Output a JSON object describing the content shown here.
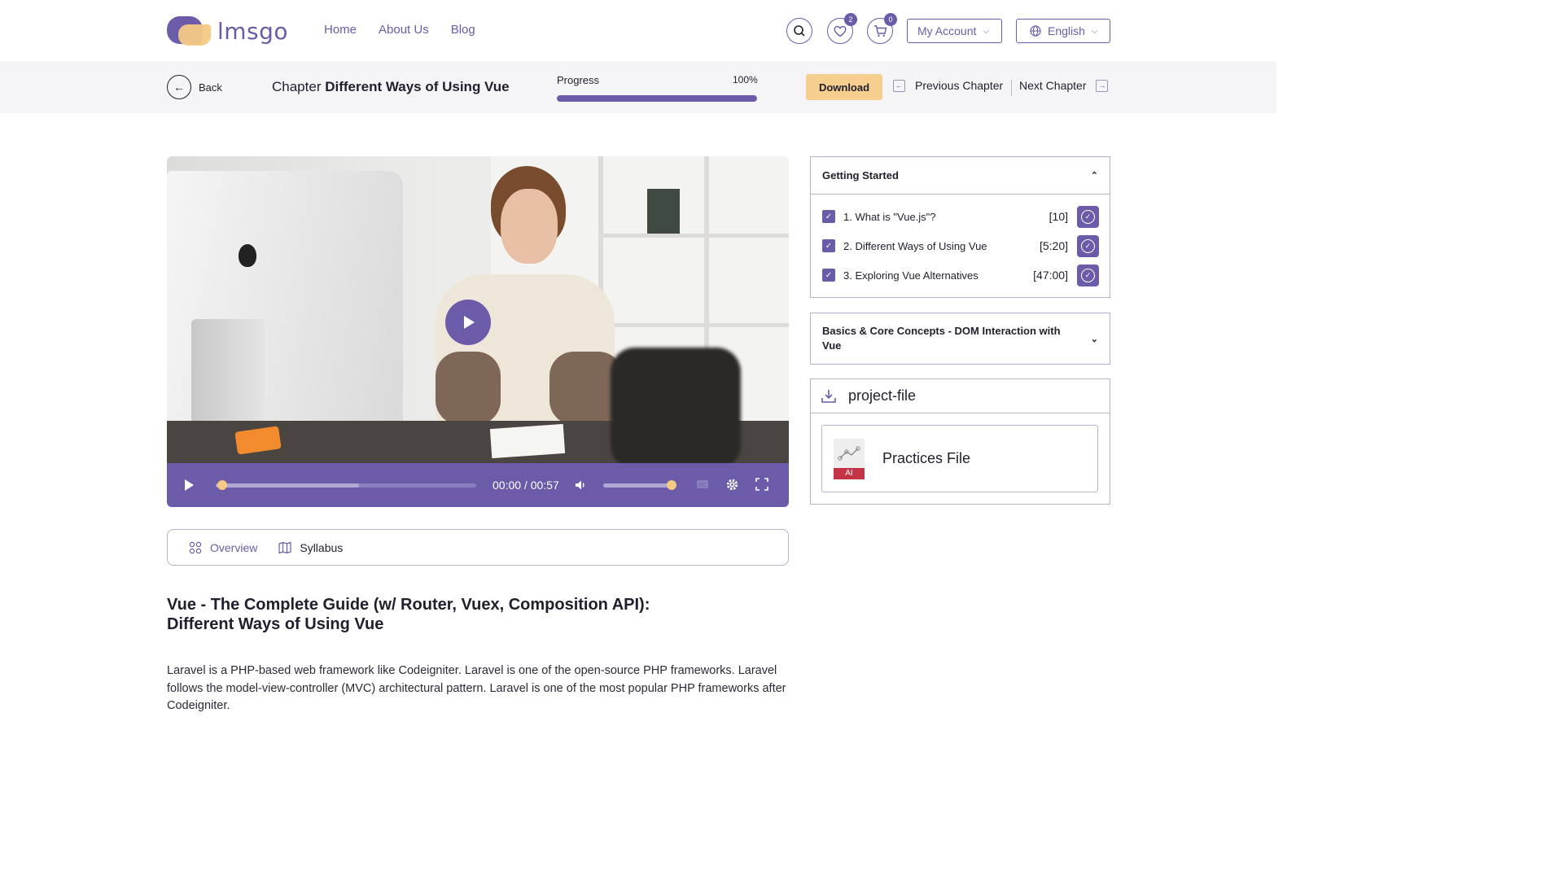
{
  "header": {
    "logo_text": "lmsgo",
    "nav": [
      "Home",
      "About Us",
      "Blog"
    ],
    "wishlist_count": "2",
    "cart_count": "0",
    "account_label": "My Account",
    "language_label": "English"
  },
  "chapter_bar": {
    "back_label": "Back",
    "chapter_prefix": "Chapter",
    "chapter_name": "Different Ways of Using Vue",
    "progress_label": "Progress",
    "progress_percent_text": "100%",
    "progress_value": 1.0,
    "download_label": "Download",
    "previous_label": "Previous Chapter",
    "next_label": "Next Chapter"
  },
  "player": {
    "time_text": "00:00 / 00:57",
    "seek_fraction": 0.0,
    "buffered_fraction": 0.55,
    "volume_fraction": 1.0
  },
  "tabs": [
    "Overview",
    "Syllabus"
  ],
  "course": {
    "title_line1": "Vue - The Complete Guide (w/ Router, Vuex, Composition API):",
    "title_line2": "Different Ways of Using Vue",
    "description": "Laravel is a PHP-based web framework like Codeigniter. Laravel is one of the open-source PHP frameworks. Laravel follows the model-view-controller (MVC) architectural pattern. Laravel is one of the most popular PHP frameworks after Codeigniter."
  },
  "sidebar": {
    "section1": {
      "title": "Getting Started",
      "lessons": [
        {
          "label": "1. What is \"Vue.js\"?",
          "duration": "[10]"
        },
        {
          "label": "2. Different Ways of Using Vue",
          "duration": "[5:20]"
        },
        {
          "label": "3. Exploring Vue Alternatives",
          "duration": "[47:00]"
        }
      ]
    },
    "section2": {
      "title": "Basics & Core Concepts - DOM Interaction with Vue"
    },
    "files": {
      "title": "project-file",
      "file_name": "Practices File",
      "file_badge": "AI"
    }
  },
  "colors": {
    "primary": "#6b5ba8",
    "accent": "#f6cf8f"
  }
}
